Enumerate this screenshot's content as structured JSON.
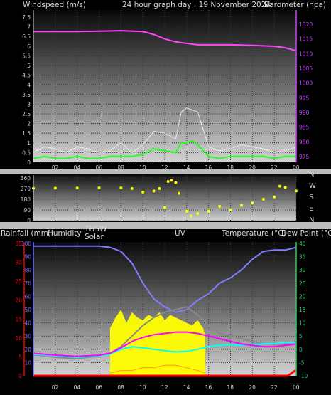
{
  "colors": {
    "wind_gust": "#e8e8e8",
    "wind_avg": "#22ff22",
    "barometer": "#ff44ff",
    "direction": "#ffff00",
    "humidity": "#7f7fff",
    "temperature": "#ff00ff",
    "dewpoint": "#00ffff",
    "thsw": "#888888",
    "solar": "#ffff00",
    "rain": "#ff0000",
    "uv": "#ff9900",
    "left_axis_red": "#ff0000",
    "left_axis_blue": "#6f6fff",
    "right_axis_purple": "#cc44ff",
    "right_axis_green": "#33cc66"
  },
  "header": {
    "left": "Windspeed (m/s)",
    "center": "24 hour graph day : 19 November 2024",
    "right": "Barometer (hpa)"
  },
  "bottom_header": {
    "rain": "Rainfall (mm)",
    "humidity": "Humidity",
    "thsw": "THSW",
    "solar": "Solar",
    "uv": "UV",
    "temperature": "Temperature (°C)",
    "dewpoint": "Dew Point (°C)"
  },
  "compass": [
    "N",
    "W",
    "S",
    "E",
    "N"
  ],
  "chart_data": [
    {
      "type": "line",
      "x_ticks": [
        "02",
        "04",
        "06",
        "08",
        "10",
        "12",
        "14",
        "16",
        "18",
        "20",
        "22",
        "00"
      ],
      "y_left_label": "Windspeed (m/s)",
      "y_left_ticks": [
        "0",
        "0.5",
        "1",
        "1.5",
        "2",
        "2.5",
        "3",
        "3.5",
        "4",
        "4.5",
        "5",
        "5.5",
        "6",
        "6.5",
        "7",
        "7.5"
      ],
      "ylim_left": [
        0,
        7.5
      ],
      "y_right_label": "Barometer (hpa)",
      "y_right_ticks": [
        "975",
        "980",
        "985",
        "990",
        "995",
        "1000",
        "1005",
        "1010",
        "1015",
        "1020"
      ],
      "ylim_right": [
        975,
        1020
      ],
      "series": [
        {
          "name": "Barometer",
          "axis": "right",
          "x": [
            0,
            4,
            8,
            10,
            11,
            12,
            13,
            14,
            15,
            16,
            18,
            20,
            22,
            23,
            24
          ],
          "y": [
            1017.5,
            1017.5,
            1017.8,
            1017.5,
            1016.5,
            1015,
            1014,
            1013.5,
            1013,
            1013,
            1013,
            1012.8,
            1012.5,
            1012,
            1011
          ]
        },
        {
          "name": "Wind gust",
          "axis": "left",
          "x": [
            0,
            1,
            2,
            3,
            4,
            5,
            6,
            7,
            8,
            9,
            10,
            11,
            12,
            13,
            13.5,
            14,
            14.5,
            15,
            16,
            17,
            18,
            19,
            20,
            21,
            22,
            23,
            24
          ],
          "y": [
            0.5,
            0.8,
            0.7,
            0.5,
            0.8,
            0.7,
            0.5,
            0.6,
            1.0,
            0.5,
            0.9,
            1.6,
            1.5,
            1.2,
            2.6,
            2.8,
            2.7,
            2.6,
            0.8,
            0.6,
            0.7,
            0.9,
            0.8,
            0.7,
            0.5,
            0.6,
            0.8
          ]
        },
        {
          "name": "Wind avg",
          "axis": "left",
          "x": [
            0,
            1,
            2,
            3,
            4,
            5,
            6,
            7,
            8,
            9,
            10,
            11,
            12,
            13,
            13.5,
            14,
            14.5,
            15,
            16,
            17,
            18,
            19,
            20,
            21,
            22,
            23,
            24
          ],
          "y": [
            0.2,
            0.3,
            0.2,
            0.2,
            0.3,
            0.2,
            0.2,
            0.3,
            0.3,
            0.3,
            0.4,
            0.7,
            0.6,
            0.5,
            1.0,
            1.0,
            1.1,
            0.9,
            0.3,
            0.2,
            0.3,
            0.3,
            0.3,
            0.3,
            0.2,
            0.3,
            0.3
          ]
        }
      ]
    },
    {
      "type": "scatter",
      "x_ticks": [
        "02",
        "04",
        "06",
        "08",
        "10",
        "12",
        "14",
        "16",
        "18",
        "20",
        "22",
        "00"
      ],
      "y_ticks": [
        "0",
        "90",
        "180",
        "270",
        "360"
      ],
      "ylim": [
        0,
        360
      ],
      "series": [
        {
          "name": "Wind direction",
          "x": [
            0,
            2,
            4,
            6,
            8,
            9,
            10,
            11,
            11.5,
            12,
            12.3,
            12.6,
            13,
            13.3,
            14,
            14.4,
            15,
            16,
            17,
            18,
            19,
            20,
            21,
            22,
            22.5,
            23,
            24
          ],
          "y": [
            272,
            274,
            275,
            276,
            276,
            270,
            240,
            250,
            270,
            110,
            330,
            340,
            320,
            230,
            80,
            40,
            60,
            80,
            120,
            90,
            130,
            150,
            180,
            200,
            290,
            280,
            250
          ]
        }
      ]
    },
    {
      "type": "line",
      "x_ticks": [
        "02",
        "04",
        "06",
        "08",
        "10",
        "12",
        "14",
        "16",
        "18",
        "20",
        "22",
        "00"
      ],
      "y_left_red_ticks": [
        "0",
        "5",
        "10",
        "15",
        "20",
        "25",
        "30",
        "35"
      ],
      "ylim_left_red": [
        0,
        35
      ],
      "y_left_blue_ticks": [
        "10",
        "20",
        "30",
        "40",
        "50",
        "60",
        "70",
        "80",
        "90",
        "100"
      ],
      "ylim_left_blue": [
        0,
        100
      ],
      "y_right_ticks": [
        "-10",
        "-5",
        "0",
        "5",
        "10",
        "15",
        "20",
        "25",
        "30",
        "35",
        "40"
      ],
      "ylim_right": [
        -10,
        40
      ],
      "series": [
        {
          "name": "Humidity",
          "axis": "left_blue",
          "x": [
            0,
            2,
            4,
            6,
            7,
            8,
            9,
            10,
            11,
            12,
            13,
            14,
            15,
            16,
            17,
            18,
            19,
            20,
            21,
            22,
            23,
            24
          ],
          "y": [
            98,
            98,
            98,
            98,
            97,
            94,
            85,
            70,
            58,
            52,
            48,
            50,
            57,
            62,
            70,
            74,
            80,
            88,
            94,
            95,
            95,
            97
          ]
        },
        {
          "name": "Temperature",
          "axis": "right",
          "x": [
            0,
            2,
            4,
            6,
            7,
            8,
            9,
            10,
            11,
            12,
            13,
            14,
            15,
            16,
            17,
            18,
            19,
            20,
            21,
            22,
            23,
            24
          ],
          "y": [
            -1.5,
            -2.2,
            -2.7,
            -2.2,
            -1.5,
            0.5,
            3,
            4.5,
            5.5,
            6,
            6.5,
            6.5,
            6,
            5,
            4,
            3,
            2,
            1.5,
            1,
            1,
            1.5,
            2
          ]
        },
        {
          "name": "Dew Point",
          "axis": "right",
          "x": [
            0,
            2,
            4,
            6,
            7,
            8,
            9,
            10,
            11,
            12,
            13,
            14,
            15,
            16,
            17,
            18,
            19,
            20,
            21,
            22,
            23,
            24
          ],
          "y": [
            -1.8,
            -2.5,
            -3,
            -2.5,
            -1.8,
            0,
            1,
            0.5,
            0,
            -0.5,
            -1,
            -0.8,
            0,
            1,
            1.5,
            1.8,
            1.5,
            1.8,
            2,
            2.2,
            2.5,
            2.5
          ]
        },
        {
          "name": "THSW",
          "axis": "right",
          "x": [
            0,
            2,
            4,
            6,
            7,
            8,
            9,
            10,
            11,
            12,
            13,
            14,
            15,
            16,
            17,
            18,
            19,
            20,
            21,
            22,
            23,
            24
          ],
          "y": [
            -2,
            -3,
            -3.5,
            -2.5,
            -1.5,
            1,
            5,
            9,
            12,
            14,
            15,
            16,
            13,
            9,
            6,
            5,
            4,
            3,
            2,
            2,
            2,
            2.5
          ]
        },
        {
          "name": "Solar",
          "axis": "right",
          "x": [
            7,
            7.5,
            8,
            8.5,
            9,
            9.5,
            10,
            10.5,
            11,
            11.5,
            12,
            12.5,
            13,
            13.5,
            14,
            14.5,
            15,
            15.5,
            15.7
          ],
          "y": [
            8,
            12,
            15,
            10,
            14,
            12,
            11,
            13,
            12,
            14,
            11,
            13,
            12,
            11,
            10,
            9,
            11,
            8,
            5
          ]
        },
        {
          "name": "UV",
          "axis": "right",
          "x": [
            7,
            8,
            9,
            10,
            11,
            12,
            13,
            14,
            15,
            15.7
          ],
          "y": [
            -9,
            -8,
            -8,
            -7,
            -7,
            -6,
            -6,
            -7,
            -8,
            -9
          ]
        },
        {
          "name": "Rainfall",
          "axis": "left_red",
          "x": [
            0,
            23.2,
            23.5,
            23.7,
            24
          ],
          "y": [
            0,
            0,
            0.5,
            1.0,
            1.5
          ]
        }
      ]
    }
  ]
}
